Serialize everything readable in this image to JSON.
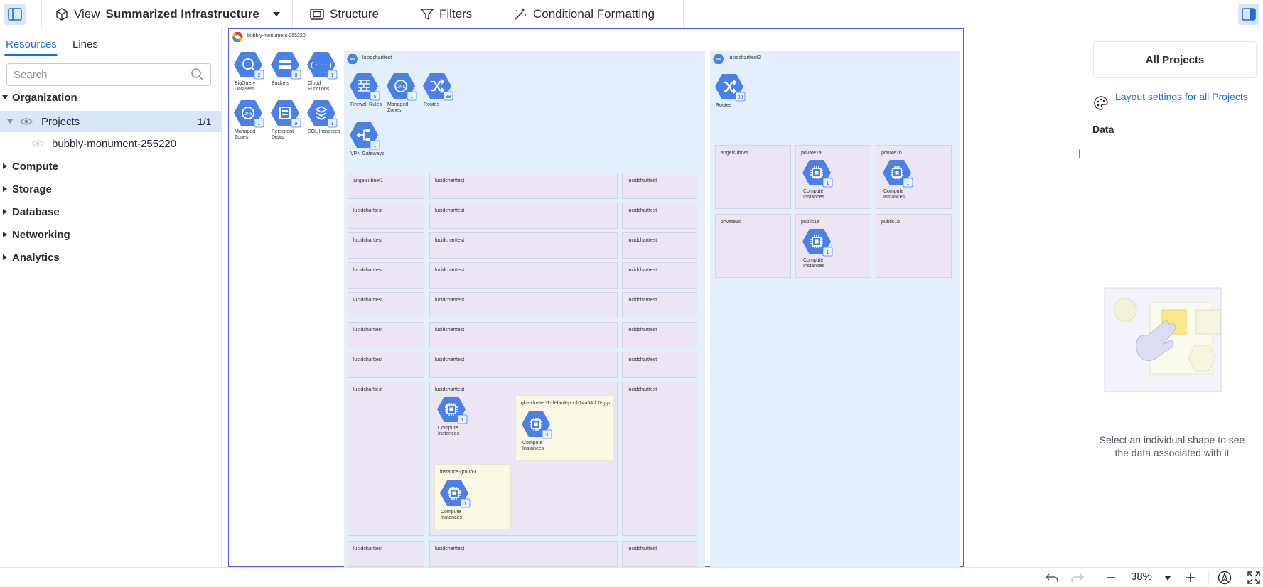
{
  "topbar": {
    "view_prefix": "View",
    "view_name": "Summarized Infrastructure",
    "structure_label": "Structure",
    "filters_label": "Filters",
    "conditional_label": "Conditional Formatting"
  },
  "left": {
    "tabs": [
      "Resources",
      "Lines"
    ],
    "search_placeholder": "Search",
    "tree": {
      "organization": "Organization",
      "projects": "Projects",
      "projects_count": "1/1",
      "project_item": "bubbly-monument-255220",
      "compute": "Compute",
      "storage": "Storage",
      "database": "Database",
      "networking": "Networking",
      "analytics": "Analytics"
    }
  },
  "diagram": {
    "project_name": "bubbly-monument-255220",
    "project_resources": [
      {
        "name": "BigQuery Datasets",
        "count": "2",
        "icon": "bigquery-icon"
      },
      {
        "name": "Buckets",
        "count": "8",
        "icon": "bucket-icon"
      },
      {
        "name": "Cloud Functions",
        "count": "1",
        "icon": "cloud-functions-icon"
      },
      {
        "name": "Managed Zones",
        "count": "1",
        "icon": "dns-icon"
      },
      {
        "name": "Persistent Disks",
        "count": "9",
        "icon": "disk-icon"
      },
      {
        "name": "SQL Instances",
        "count": "1",
        "icon": "sql-icon"
      }
    ],
    "vpc1": {
      "name": "lucidcharttest",
      "resources": [
        {
          "name": "Firewall Rules",
          "count": "5",
          "icon": "firewall-icon"
        },
        {
          "name": "Managed Zones",
          "count": "1",
          "icon": "dns-icon"
        },
        {
          "name": "Routes",
          "count": "39",
          "icon": "routes-icon"
        },
        {
          "name": "VPN Gateways",
          "count": "1",
          "icon": "vpn-icon"
        }
      ],
      "first_subnet": "angelsubnet1",
      "subnet_label": "lucidcharttest",
      "ig1": "gke-cluster-1-default-pool-14a54dc0-grp",
      "ig2": "instance-group-1",
      "ci_label": "Compute Instances",
      "ci_count_a": "1",
      "ci_count_b": "3",
      "ci_count_c": "1"
    },
    "vpc2": {
      "name": "lucidcharttest2",
      "routes_label": "Routes",
      "routes_count": "39",
      "subnets": [
        "angelsubnet",
        "private1a",
        "private1b",
        "private1c",
        "public1a",
        "public1b"
      ],
      "ci_label": "Compute Instances",
      "ci_count": "1"
    }
  },
  "right": {
    "all_projects": "All Projects",
    "layout_link": "Layout settings for all Projects",
    "data_heading": "Data",
    "empty_msg": "Select an individual shape to see the data associated with it"
  },
  "bottom": {
    "zoom": "38%"
  }
}
